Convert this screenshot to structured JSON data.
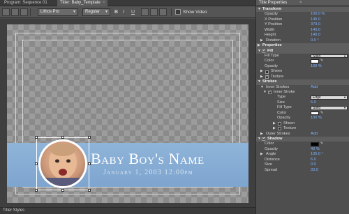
{
  "tabs": {
    "program": "Program: Sequence 01",
    "titler": "Titler: Baby_Template",
    "panel_title": "Title Properties",
    "bottom": "Titler Styles"
  },
  "toolbar": {
    "font": "Lithos Pro",
    "style": "Regular",
    "bold_glyph": "B",
    "italic_glyph": "I",
    "underline_glyph": "U",
    "show_video_label": "Show Video"
  },
  "canvas": {
    "title": "Baby Boy's Name",
    "subtitle": "January 1, 2003  12:00pm"
  },
  "colors": {
    "banner": "#8fb4d9",
    "value_blue": "#7fb2ff",
    "fill_color": "#ffffff",
    "stroke_color": "#ffffff",
    "shadow_color": "#000000"
  },
  "properties": {
    "transform": "Transform",
    "opacity_lbl": "Opacity",
    "opacity_val": "100.0 %",
    "xpos_lbl": "X Position",
    "xpos_val": "145.0",
    "ypos_lbl": "Y Position",
    "ypos_val": "373.0",
    "width_lbl": "Width",
    "width_val": "140.0",
    "height_lbl": "Height",
    "height_val": "140.0",
    "rotation_lbl": "Rotation",
    "rotation_val": "0.0 °",
    "properties": "Properties",
    "fill": "Fill",
    "filltype_lbl": "Fill Type",
    "filltype_val": "Solid",
    "color_lbl": "Color",
    "fill_opacity_lbl": "Opacity",
    "fill_opacity_val": "100 %",
    "sheen": "Sheen",
    "texture": "Texture",
    "strokes": "Strokes",
    "inner_strokes": "Inner Strokes",
    "add": "Add",
    "inner_stroke": "Inner Stroke",
    "type_lbl": "Type",
    "type_val": "Edge",
    "size_lbl": "Size",
    "size_val": "6.0",
    "s_filltype_lbl": "Fill Type",
    "s_filltype_val": "Solid",
    "s_color_lbl": "Color",
    "s_opacity_lbl": "Opacity",
    "s_opacity_val": "100 %",
    "s_sheen": "Sheen",
    "s_texture": "Texture",
    "outer_strokes": "Outer Strokes",
    "add2": "Add",
    "shadow": "Shadow",
    "sh_color_lbl": "Color",
    "sh_opacity_lbl": "Opacity",
    "sh_opacity_val": "40 %",
    "sh_angle_lbl": "Angle",
    "sh_angle_val": "135.0 °",
    "sh_distance_lbl": "Distance",
    "sh_distance_val": "6.0",
    "sh_size_lbl": "Size",
    "sh_size_val": "0.0",
    "sh_spread_lbl": "Spread",
    "sh_spread_val": "33.0"
  }
}
